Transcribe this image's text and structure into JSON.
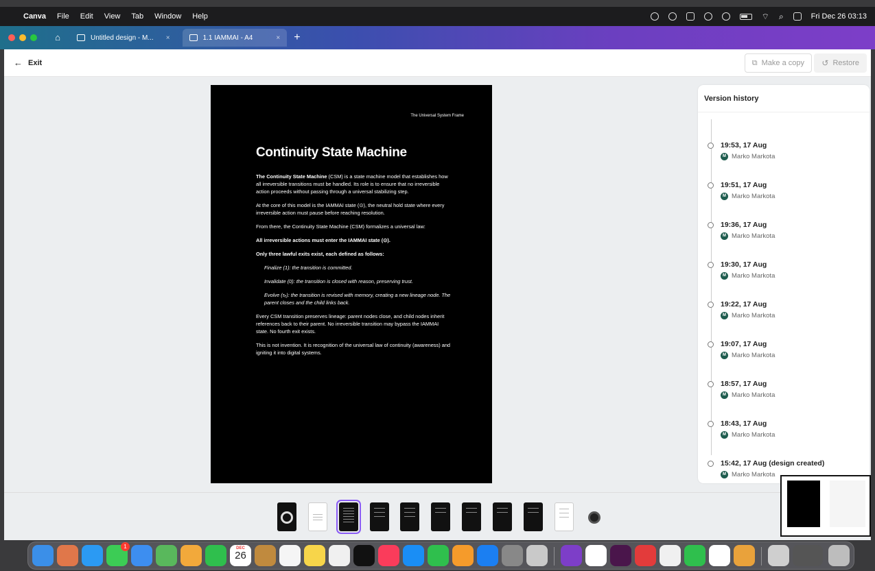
{
  "menubar": {
    "app_name": "Canva",
    "menus": [
      "File",
      "Edit",
      "View",
      "Tab",
      "Window",
      "Help"
    ],
    "clock": "Fri Dec 26  03:13"
  },
  "tabs": [
    {
      "label": "Untitled design - M...",
      "close": "×"
    },
    {
      "label": "1.1 IAMMAI - A4",
      "close": "×"
    }
  ],
  "header": {
    "exit_label": "Exit",
    "make_copy_label": "Make a copy",
    "restore_label": "Restore"
  },
  "document": {
    "header_text": "The Universal System Frame",
    "title": "Continuity State Machine",
    "p1_bold": "The Continuity State Machine",
    "p1_rest": " (CSM) is a state machine model that establishes how all irreversible transitions must be handled. Its role is to ensure that no irreversible action proceeds without passing through a universal stabilizing step.",
    "p2": "At the core of this model is the IAMMAI state (⊙), the neutral hold state where every irreversible action must pause before reaching resolution.",
    "p3": "From there, the Continuity State Machine (CSM) formalizes a universal law:",
    "p4": "All irreversible actions must enter the IAMMAI state (⊙).",
    "p5": "Only three lawful exits exist, each defined as follows:",
    "exit1": "Finalize (1): the transition is committed.",
    "exit2": "Invalidate (0): the transition is closed with reason, preserving trust.",
    "exit3": "Evolve (τₑ): the transition is revised with memory, creating a new lineage node. The parent closes and the child links back.",
    "p6": "Every CSM transition preserves lineage: parent nodes close, and child nodes inherit references back to their parent. No irreversible transition may bypass the IAMMAI state. No fourth exit exists.",
    "p7": "This is not invention. It is recognition of the universal law of continuity (awareness) and igniting it into digital systems."
  },
  "version_history": {
    "title": "Version history",
    "entries": [
      {
        "time": "19:53, 17 Aug",
        "user": "Marko Markota",
        "initial": "M"
      },
      {
        "time": "19:51, 17 Aug",
        "user": "Marko Markota",
        "initial": "M"
      },
      {
        "time": "19:36, 17 Aug",
        "user": "Marko Markota",
        "initial": "M"
      },
      {
        "time": "19:30, 17 Aug",
        "user": "Marko Markota",
        "initial": "M"
      },
      {
        "time": "19:22, 17 Aug",
        "user": "Marko Markota",
        "initial": "M"
      },
      {
        "time": "19:07, 17 Aug",
        "user": "Marko Markota",
        "initial": "M"
      },
      {
        "time": "18:57, 17 Aug",
        "user": "Marko Markota",
        "initial": "M"
      },
      {
        "time": "18:43, 17 Aug",
        "user": "Marko Markota",
        "initial": "M"
      },
      {
        "time": "15:42, 17 Aug (design created)",
        "user": "Marko Markota",
        "initial": "M"
      }
    ]
  },
  "dock": {
    "calendar_month": "DEC",
    "calendar_day": "26",
    "messages_badge": "1"
  },
  "colors": {
    "accent": "#8b5cf6",
    "avatar": "#1e5c4e"
  }
}
